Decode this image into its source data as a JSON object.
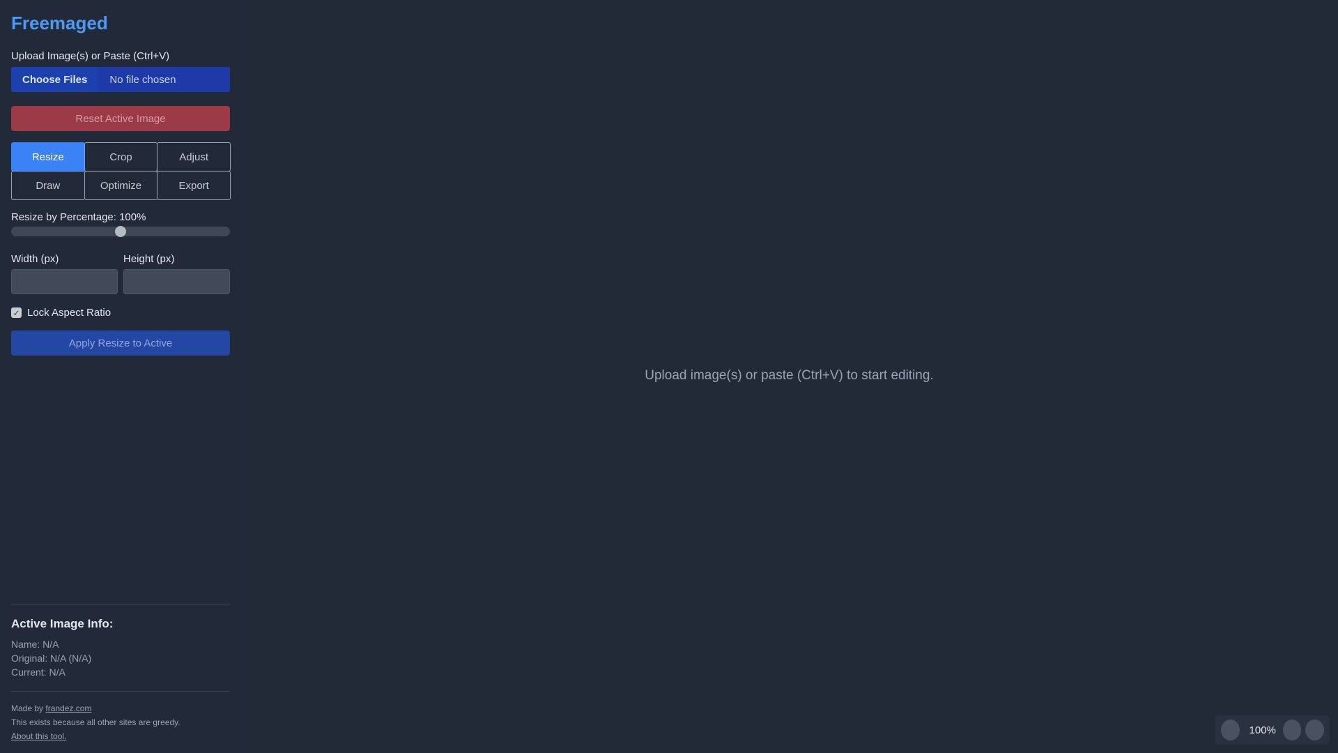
{
  "app": {
    "title": "Freemaged"
  },
  "upload": {
    "label": "Upload Image(s) or Paste (Ctrl+V)",
    "choose_label": "Choose Files",
    "no_file": "No file chosen"
  },
  "reset": {
    "label": "Reset Active Image"
  },
  "tabs": [
    {
      "label": "Resize",
      "active": true
    },
    {
      "label": "Crop",
      "active": false
    },
    {
      "label": "Adjust",
      "active": false
    },
    {
      "label": "Draw",
      "active": false
    },
    {
      "label": "Optimize",
      "active": false
    },
    {
      "label": "Export",
      "active": false
    }
  ],
  "resize": {
    "percentage_label": "Resize by Percentage: 100%",
    "percentage_value": 100,
    "percentage_min": 0,
    "percentage_max": 200,
    "width_label": "Width (px)",
    "height_label": "Height (px)",
    "width_value": "",
    "height_value": "",
    "lock_label": "Lock Aspect Ratio",
    "lock_checked": true,
    "apply_label": "Apply Resize to Active"
  },
  "info": {
    "title": "Active Image Info:",
    "name": "Name: N/A",
    "original": "Original: N/A (N/A)",
    "current": "Current: N/A"
  },
  "footer": {
    "made_by_prefix": "Made by",
    "made_by_link": "frandez.com",
    "tagline": "This exists because all other sites are greedy.",
    "about_link": "About this tool."
  },
  "canvas": {
    "message": "Upload image(s) or paste (Ctrl+V) to start editing."
  },
  "zoom": {
    "label": "100%"
  },
  "icons": {
    "checkbox": "checkmark-icon"
  }
}
